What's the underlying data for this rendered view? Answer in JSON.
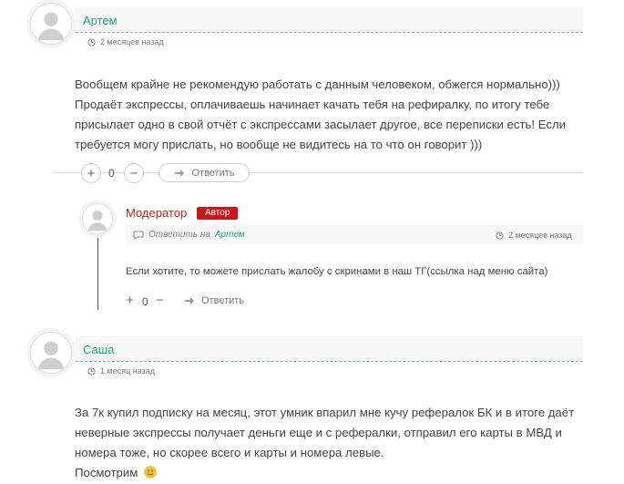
{
  "comments": [
    {
      "author": "Артем",
      "time": "2 месяцев назад",
      "paragraphs": [
        "Вообщем крайне не рекомендую работать с данным человеком, обжегся нормально)))",
        "Продаёт экспрессы, оплачиваешь начинает качать тебя на рефиралку, по итогу тебе",
        "присылает одно в свой отчёт с экспрессами засылает другое, все переписки есть! Если",
        "требуется могу прислать, но вообще не видитесь на то что он говорит )))"
      ],
      "vote_count": "0",
      "reply_label": "Ответить"
    },
    {
      "author": "Модератор",
      "badge": "Автор",
      "reply_to_prefix": "Ответить на",
      "reply_to_name": "Артем",
      "time": "2 месяцев назад",
      "paragraphs": [
        "Если хотите, то можете прислать жалобу с скринами в наш ТГ(ссылка над меню сайта)"
      ],
      "vote_count": "0",
      "reply_label": "Ответить"
    },
    {
      "author": "Саша",
      "time": "1 месяц назад",
      "paragraphs": [
        "За 7к купил подписку на месяц, этот умник впарил мне кучу рефералок БК и в итоге даёт",
        "неверные экспрессы получает деньги еще и с рефералки, отправил его карты в МВД и",
        "номера тоже, но скорее всего и карты и номера левые.",
        "Посмотрим"
      ]
    }
  ],
  "icons": {
    "clock": "clock-icon",
    "plus": "+",
    "minus": "−",
    "reply": "reply-arrow-icon",
    "quote": "speech-bubble-icon",
    "smile": "smile-emoji"
  },
  "colors": {
    "author": "#1fa38a",
    "moderator": "#c0201c",
    "badge_bg": "#c8161d",
    "dashed": "#5cc2ae"
  }
}
